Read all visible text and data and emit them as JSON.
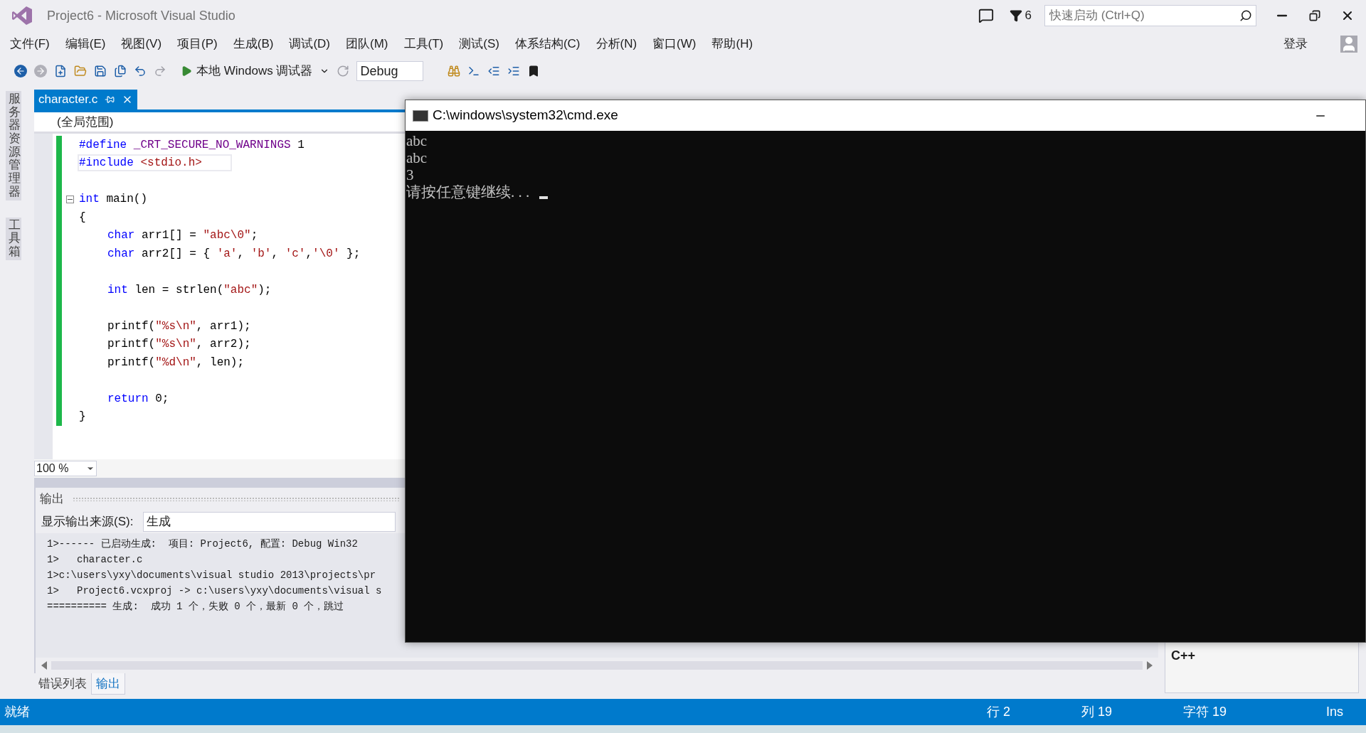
{
  "window": {
    "title": "Project6 - Microsoft Visual Studio"
  },
  "notifications": {
    "count": "6"
  },
  "quick_launch": {
    "placeholder": "快速启动 (Ctrl+Q)"
  },
  "menu": [
    "文件(F)",
    "编辑(E)",
    "视图(V)",
    "项目(P)",
    "生成(B)",
    "调试(D)",
    "团队(M)",
    "工具(T)",
    "测试(S)",
    "体系结构(C)",
    "分析(N)",
    "窗口(W)",
    "帮助(H)"
  ],
  "sign_in": "登录",
  "toolbar": {
    "start_label": "本地 Windows 调试器",
    "configuration": "Debug"
  },
  "side_tabs": [
    "服务器资源管理器",
    "工具箱"
  ],
  "editor": {
    "tabs": [
      {
        "label": "character.c",
        "selected": true
      }
    ],
    "scope": "(全局范围)",
    "zoom": "100 %",
    "lines": [
      {
        "kind": "code",
        "indented": false,
        "current": false,
        "tokens": [
          {
            "kind": "preprocessor",
            "text": "#define "
          },
          {
            "kind": "macro",
            "text": "_CRT_SECURE_NO_WARNINGS"
          },
          {
            "kind": "plain",
            "text": " 1"
          }
        ]
      },
      {
        "kind": "code",
        "indented": false,
        "current": true,
        "tokens": [
          {
            "kind": "preprocessor",
            "text": "#include "
          },
          {
            "kind": "string",
            "text": "<stdio.h>"
          }
        ]
      },
      {
        "kind": "blank"
      },
      {
        "kind": "fold",
        "indented": false,
        "current": false,
        "tokens": [
          {
            "kind": "keyword",
            "text": "int"
          },
          {
            "kind": "plain",
            "text": " main()"
          }
        ]
      },
      {
        "kind": "code",
        "indented": false,
        "current": false,
        "tokens": [
          {
            "kind": "plain",
            "text": "{"
          }
        ]
      },
      {
        "kind": "code",
        "indented": true,
        "current": false,
        "tokens": [
          {
            "kind": "keyword",
            "text": "char"
          },
          {
            "kind": "plain",
            "text": " arr1[] = "
          },
          {
            "kind": "string",
            "text": "\"abc\\0\""
          },
          {
            "kind": "plain",
            "text": ";"
          }
        ]
      },
      {
        "kind": "code",
        "indented": true,
        "current": false,
        "tokens": [
          {
            "kind": "keyword",
            "text": "char"
          },
          {
            "kind": "plain",
            "text": " arr2[] = { "
          },
          {
            "kind": "string",
            "text": "'a'"
          },
          {
            "kind": "plain",
            "text": ", "
          },
          {
            "kind": "string",
            "text": "'b'"
          },
          {
            "kind": "plain",
            "text": ", "
          },
          {
            "kind": "string",
            "text": "'c'"
          },
          {
            "kind": "plain",
            "text": ","
          },
          {
            "kind": "string",
            "text": "'\\0'"
          },
          {
            "kind": "plain",
            "text": " };"
          }
        ]
      },
      {
        "kind": "blank"
      },
      {
        "kind": "code",
        "indented": true,
        "current": false,
        "tokens": [
          {
            "kind": "keyword",
            "text": "int"
          },
          {
            "kind": "plain",
            "text": " len = strlen("
          },
          {
            "kind": "string",
            "text": "\"abc\""
          },
          {
            "kind": "plain",
            "text": ");"
          }
        ]
      },
      {
        "kind": "blank"
      },
      {
        "kind": "code",
        "indented": true,
        "current": false,
        "tokens": [
          {
            "kind": "plain",
            "text": "printf("
          },
          {
            "kind": "string",
            "text": "\"%s\\n\""
          },
          {
            "kind": "plain",
            "text": ", arr1);"
          }
        ]
      },
      {
        "kind": "code",
        "indented": true,
        "current": false,
        "tokens": [
          {
            "kind": "plain",
            "text": "printf("
          },
          {
            "kind": "string",
            "text": "\"%s\\n\""
          },
          {
            "kind": "plain",
            "text": ", arr2);"
          }
        ]
      },
      {
        "kind": "code",
        "indented": true,
        "current": false,
        "tokens": [
          {
            "kind": "plain",
            "text": "printf("
          },
          {
            "kind": "string",
            "text": "\"%d\\n\""
          },
          {
            "kind": "plain",
            "text": ", len);"
          }
        ]
      },
      {
        "kind": "blank"
      },
      {
        "kind": "code",
        "indented": true,
        "current": false,
        "tokens": [
          {
            "kind": "keyword",
            "text": "return"
          },
          {
            "kind": "plain",
            "text": " 0;"
          }
        ]
      },
      {
        "kind": "code",
        "indented": false,
        "current": false,
        "tokens": [
          {
            "kind": "plain",
            "text": "}"
          }
        ]
      }
    ]
  },
  "cmd_window": {
    "title": "C:\\windows\\system32\\cmd.exe",
    "lines": [
      "abc",
      "abc",
      "3",
      "请按任意键继续. . ."
    ]
  },
  "output": {
    "title": "输出",
    "source_label": "显示输出来源(S):",
    "source": "生成",
    "lines": [
      "1>------ 已启动生成:  项目: Project6, 配置: Debug Win32",
      "1>   character.c",
      "1>c:\\users\\yxy\\documents\\visual studio 2013\\projects\\pr",
      "1>   Project6.vcxproj -> c:\\users\\yxy\\documents\\visual s",
      "========== 生成:  成功 1 个，失败 0 个，最新 0 个，跳过"
    ]
  },
  "bottom_tabs": [
    {
      "label": "错误列表",
      "selected": false
    },
    {
      "label": "输出",
      "selected": true
    }
  ],
  "right_panel": {
    "text": "C++"
  },
  "status_bar": {
    "state": "就绪",
    "line": "行 2",
    "column": "列 19",
    "char": "字符 19",
    "mode": "Ins"
  }
}
